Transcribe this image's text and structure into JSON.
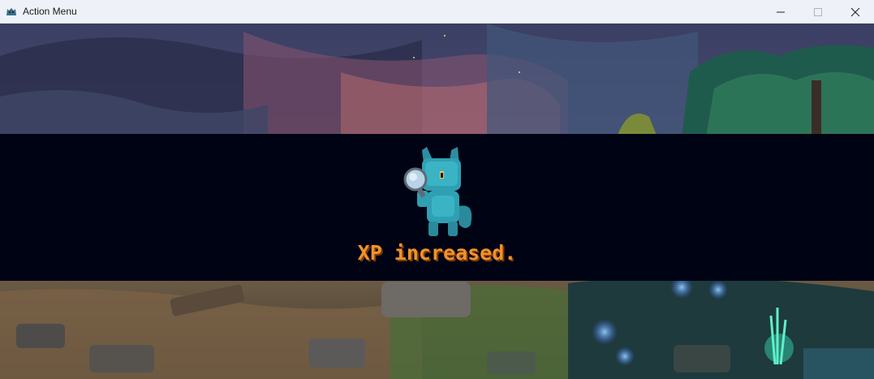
{
  "window": {
    "title": "Action Menu",
    "icon": "creature-app-icon",
    "controls": [
      "minimize-icon",
      "maximize-icon",
      "close-icon"
    ]
  },
  "scene": {
    "background": "forest-night-pixel-art",
    "banner_color": "#000314",
    "creature": "blue-cat-creature-with-magnifying-glass",
    "message": "XP increased.",
    "message_color": "#f0922c"
  }
}
